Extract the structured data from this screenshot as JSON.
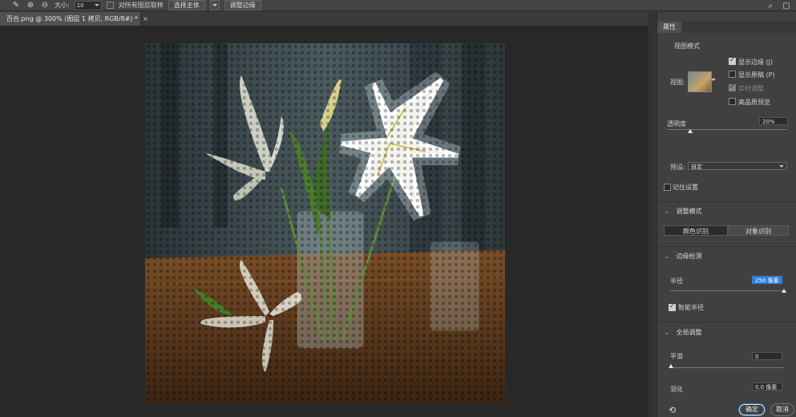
{
  "options_bar": {
    "size_label": "大小:",
    "size_value": "10",
    "sample_all_layers": "对所有图层取样",
    "select_subject": "选择主体",
    "select_and_mask": "调整边缘"
  },
  "document_tab": {
    "title": "百合.png @ 300% (图层 1 拷贝, RGB/8#) *",
    "close": "×"
  },
  "panel": {
    "tab": "属性",
    "view_mode_heading": "视图模式",
    "view_label": "视图:",
    "show_edge": "显示边缘 (J)",
    "show_original": "显示原稿 (P)",
    "realtime_refine": "实时调整",
    "high_quality_preview": "高品质预览",
    "opacity_label": "透明度",
    "opacity_value": "20%",
    "opacity_level": 0.2,
    "preset_label": "预设:",
    "preset_value": "自定",
    "remember_settings": "记住设置",
    "refine_mode_heading": "调整模式",
    "color_aware": "颜色识别",
    "object_aware": "对象识别",
    "edge_detection_heading": "边缘检测",
    "radius_label": "半径",
    "radius_value": "250 像素",
    "radius_level": 1.0,
    "smart_radius": "智能半径",
    "global_refinements_heading": "全局调整",
    "smooth_label": "平滑",
    "smooth_value": "0",
    "smooth_level": 0.0,
    "feather_label": "羽化",
    "feather_value": "0.0 像素",
    "ok_button": "确定",
    "cancel_button": "取消"
  },
  "colors": {
    "panel_bg": "#404040",
    "accent_blue": "#2f7fd8"
  }
}
